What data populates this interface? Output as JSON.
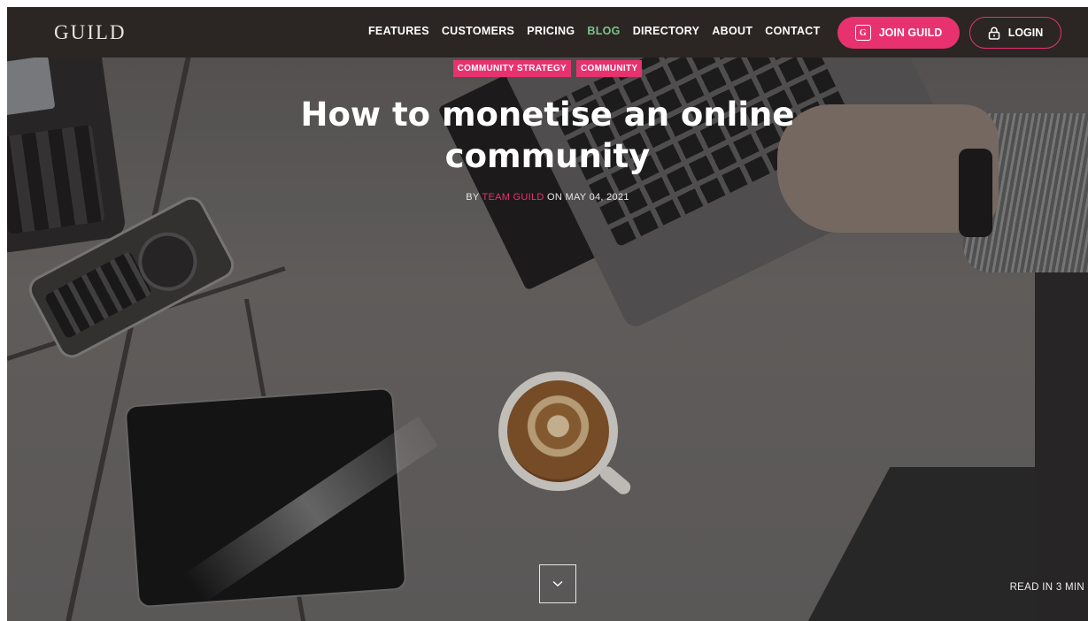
{
  "brand": {
    "logo": "GUILD"
  },
  "nav": {
    "links": [
      "FEATURES",
      "CUSTOMERS",
      "PRICING",
      "BLOG",
      "DIRECTORY",
      "ABOUT",
      "CONTACT"
    ],
    "active": "BLOG",
    "join_label": "JOIN GUILD",
    "login_label": "LOGIN"
  },
  "post": {
    "tags": [
      "COMMUNITY STRATEGY",
      "COMMUNITY"
    ],
    "title_line1": "How to monetise an online",
    "title_line2": "community",
    "by": "BY",
    "author": "TEAM GUILD",
    "on": "ON",
    "date": "MAY 04, 2021",
    "read_time": "READ IN 3 MIN"
  },
  "colors": {
    "accent": "#e8326f",
    "nav_bg": "#2b2623",
    "active_link": "#7fc28d"
  },
  "icons": {
    "join": "guild-g-icon",
    "login": "lock-icon",
    "scroll": "chevron-down-icon"
  }
}
